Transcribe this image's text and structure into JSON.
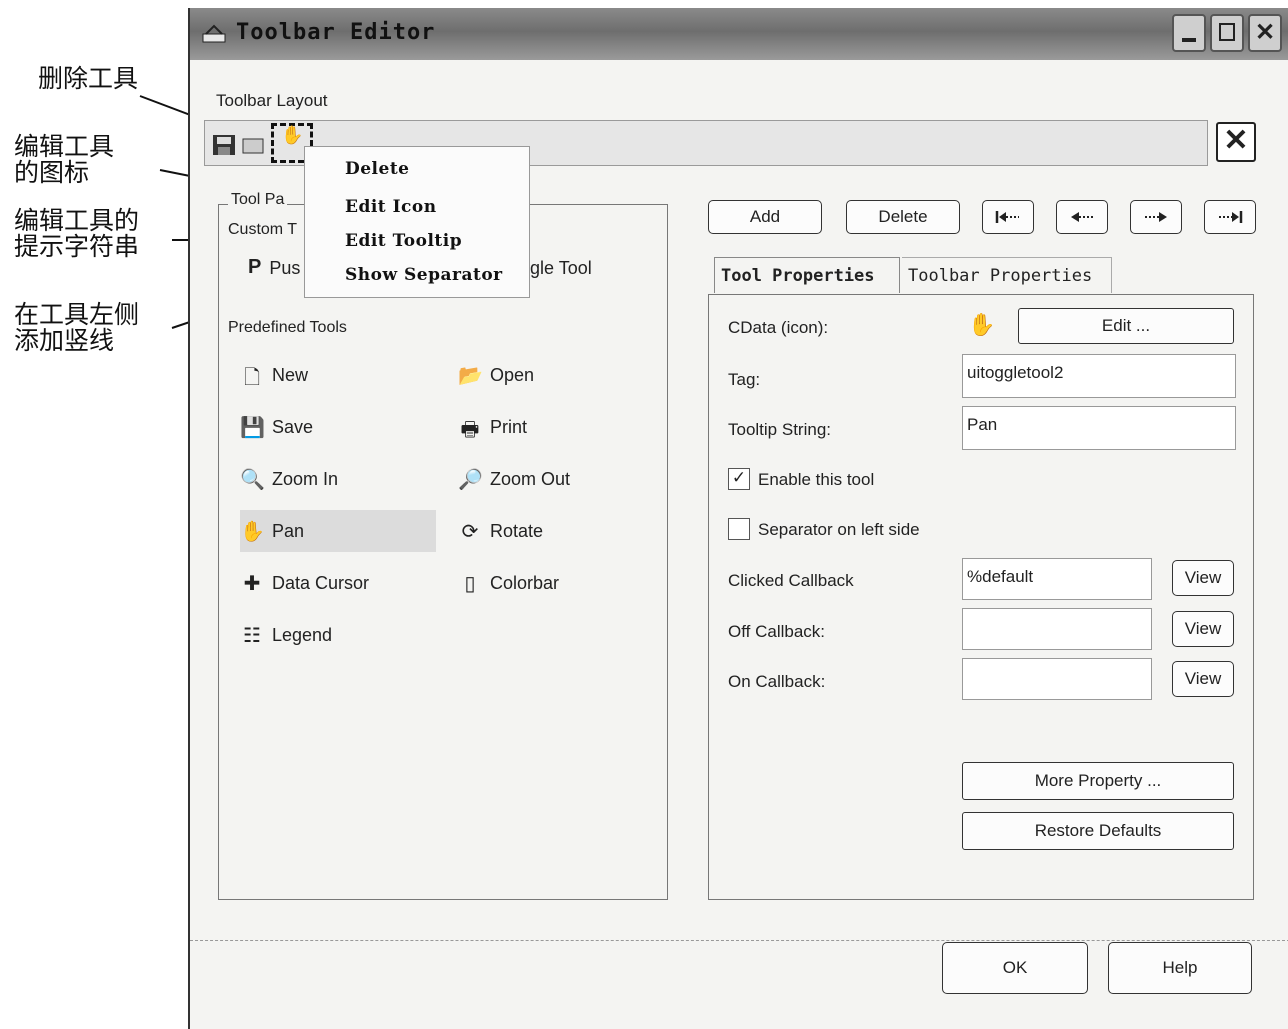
{
  "annotations": [
    {
      "text": "删除工具"
    },
    {
      "text": "编辑工具\n的图标"
    },
    {
      "text": "编辑工具的\n提示字符串"
    },
    {
      "text": "在工具左侧\n添加竖线"
    }
  ],
  "window": {
    "title": "Toolbar Editor",
    "controls": [
      "minimize-icon",
      "maximize-icon",
      "close-icon"
    ]
  },
  "layout": {
    "label": "Toolbar Layout",
    "strip_tools": [
      "save-icon",
      "open-icon",
      "pan-icon"
    ],
    "close_label": "✕"
  },
  "context_menu": {
    "items": [
      "Delete",
      "Edit Icon",
      "Edit Tooltip",
      "Show Separator"
    ]
  },
  "palette": {
    "group_label_partial": "Tool Pa",
    "custom_label_partial": "Custom T",
    "push_label_partial": "Pus",
    "toggle_label_partial": "gle Tool",
    "predefined_label": "Predefined Tools",
    "tools": [
      {
        "label": "New",
        "icon": "new-file-icon",
        "selected": false
      },
      {
        "label": "Open",
        "icon": "open-folder-icon",
        "selected": false
      },
      {
        "label": "Save",
        "icon": "save-icon",
        "selected": false
      },
      {
        "label": "Print",
        "icon": "print-icon",
        "selected": false
      },
      {
        "label": "Zoom In",
        "icon": "zoom-in-icon",
        "selected": false
      },
      {
        "label": "Zoom Out",
        "icon": "zoom-out-icon",
        "selected": false
      },
      {
        "label": "Pan",
        "icon": "pan-hand-icon",
        "selected": true
      },
      {
        "label": "Rotate",
        "icon": "rotate-icon",
        "selected": false
      },
      {
        "label": "Data Cursor",
        "icon": "data-cursor-icon",
        "selected": false
      },
      {
        "label": "Colorbar",
        "icon": "colorbar-icon",
        "selected": false
      },
      {
        "label": "Legend",
        "icon": "legend-icon",
        "selected": false
      }
    ]
  },
  "actions": {
    "add": "Add",
    "delete": "Delete",
    "move_first": "move-first-icon",
    "move_left": "move-left-icon",
    "move_right": "move-right-icon",
    "move_last": "move-last-icon"
  },
  "tabs": [
    {
      "label": "Tool Properties",
      "active": true
    },
    {
      "label": "Toolbar Properties",
      "active": false
    }
  ],
  "properties": {
    "cdata_label": "CData (icon):",
    "cdata_icon": "pan-hand-icon",
    "edit_button": "Edit ...",
    "tag_label": "Tag:",
    "tag_value": "uitoggletool2",
    "tooltip_label": "Tooltip String:",
    "tooltip_value": "Pan",
    "enable_label": "Enable this tool",
    "enable_checked": true,
    "separator_label": "Separator on left side",
    "separator_checked": false,
    "clicked_label": "Clicked Callback",
    "clicked_value": "%default",
    "off_label": "Off Callback:",
    "off_value": "",
    "on_label": "On Callback:",
    "on_value": "",
    "view_button": "View",
    "more_property": "More Property ...",
    "restore_defaults": "Restore Defaults"
  },
  "footer": {
    "ok": "OK",
    "help": "Help"
  }
}
